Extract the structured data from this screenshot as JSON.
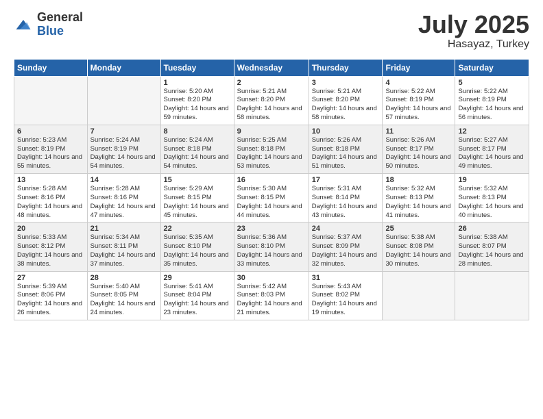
{
  "logo": {
    "general": "General",
    "blue": "Blue"
  },
  "title": {
    "month_year": "July 2025",
    "location": "Hasayaz, Turkey"
  },
  "weekdays": [
    "Sunday",
    "Monday",
    "Tuesday",
    "Wednesday",
    "Thursday",
    "Friday",
    "Saturday"
  ],
  "weeks": [
    [
      {
        "day": "",
        "sunrise": "",
        "sunset": "",
        "daylight": ""
      },
      {
        "day": "",
        "sunrise": "",
        "sunset": "",
        "daylight": ""
      },
      {
        "day": "1",
        "sunrise": "Sunrise: 5:20 AM",
        "sunset": "Sunset: 8:20 PM",
        "daylight": "Daylight: 14 hours and 59 minutes."
      },
      {
        "day": "2",
        "sunrise": "Sunrise: 5:21 AM",
        "sunset": "Sunset: 8:20 PM",
        "daylight": "Daylight: 14 hours and 58 minutes."
      },
      {
        "day": "3",
        "sunrise": "Sunrise: 5:21 AM",
        "sunset": "Sunset: 8:20 PM",
        "daylight": "Daylight: 14 hours and 58 minutes."
      },
      {
        "day": "4",
        "sunrise": "Sunrise: 5:22 AM",
        "sunset": "Sunset: 8:19 PM",
        "daylight": "Daylight: 14 hours and 57 minutes."
      },
      {
        "day": "5",
        "sunrise": "Sunrise: 5:22 AM",
        "sunset": "Sunset: 8:19 PM",
        "daylight": "Daylight: 14 hours and 56 minutes."
      }
    ],
    [
      {
        "day": "6",
        "sunrise": "Sunrise: 5:23 AM",
        "sunset": "Sunset: 8:19 PM",
        "daylight": "Daylight: 14 hours and 55 minutes."
      },
      {
        "day": "7",
        "sunrise": "Sunrise: 5:24 AM",
        "sunset": "Sunset: 8:19 PM",
        "daylight": "Daylight: 14 hours and 54 minutes."
      },
      {
        "day": "8",
        "sunrise": "Sunrise: 5:24 AM",
        "sunset": "Sunset: 8:18 PM",
        "daylight": "Daylight: 14 hours and 54 minutes."
      },
      {
        "day": "9",
        "sunrise": "Sunrise: 5:25 AM",
        "sunset": "Sunset: 8:18 PM",
        "daylight": "Daylight: 14 hours and 53 minutes."
      },
      {
        "day": "10",
        "sunrise": "Sunrise: 5:26 AM",
        "sunset": "Sunset: 8:18 PM",
        "daylight": "Daylight: 14 hours and 51 minutes."
      },
      {
        "day": "11",
        "sunrise": "Sunrise: 5:26 AM",
        "sunset": "Sunset: 8:17 PM",
        "daylight": "Daylight: 14 hours and 50 minutes."
      },
      {
        "day": "12",
        "sunrise": "Sunrise: 5:27 AM",
        "sunset": "Sunset: 8:17 PM",
        "daylight": "Daylight: 14 hours and 49 minutes."
      }
    ],
    [
      {
        "day": "13",
        "sunrise": "Sunrise: 5:28 AM",
        "sunset": "Sunset: 8:16 PM",
        "daylight": "Daylight: 14 hours and 48 minutes."
      },
      {
        "day": "14",
        "sunrise": "Sunrise: 5:28 AM",
        "sunset": "Sunset: 8:16 PM",
        "daylight": "Daylight: 14 hours and 47 minutes."
      },
      {
        "day": "15",
        "sunrise": "Sunrise: 5:29 AM",
        "sunset": "Sunset: 8:15 PM",
        "daylight": "Daylight: 14 hours and 45 minutes."
      },
      {
        "day": "16",
        "sunrise": "Sunrise: 5:30 AM",
        "sunset": "Sunset: 8:15 PM",
        "daylight": "Daylight: 14 hours and 44 minutes."
      },
      {
        "day": "17",
        "sunrise": "Sunrise: 5:31 AM",
        "sunset": "Sunset: 8:14 PM",
        "daylight": "Daylight: 14 hours and 43 minutes."
      },
      {
        "day": "18",
        "sunrise": "Sunrise: 5:32 AM",
        "sunset": "Sunset: 8:13 PM",
        "daylight": "Daylight: 14 hours and 41 minutes."
      },
      {
        "day": "19",
        "sunrise": "Sunrise: 5:32 AM",
        "sunset": "Sunset: 8:13 PM",
        "daylight": "Daylight: 14 hours and 40 minutes."
      }
    ],
    [
      {
        "day": "20",
        "sunrise": "Sunrise: 5:33 AM",
        "sunset": "Sunset: 8:12 PM",
        "daylight": "Daylight: 14 hours and 38 minutes."
      },
      {
        "day": "21",
        "sunrise": "Sunrise: 5:34 AM",
        "sunset": "Sunset: 8:11 PM",
        "daylight": "Daylight: 14 hours and 37 minutes."
      },
      {
        "day": "22",
        "sunrise": "Sunrise: 5:35 AM",
        "sunset": "Sunset: 8:10 PM",
        "daylight": "Daylight: 14 hours and 35 minutes."
      },
      {
        "day": "23",
        "sunrise": "Sunrise: 5:36 AM",
        "sunset": "Sunset: 8:10 PM",
        "daylight": "Daylight: 14 hours and 33 minutes."
      },
      {
        "day": "24",
        "sunrise": "Sunrise: 5:37 AM",
        "sunset": "Sunset: 8:09 PM",
        "daylight": "Daylight: 14 hours and 32 minutes."
      },
      {
        "day": "25",
        "sunrise": "Sunrise: 5:38 AM",
        "sunset": "Sunset: 8:08 PM",
        "daylight": "Daylight: 14 hours and 30 minutes."
      },
      {
        "day": "26",
        "sunrise": "Sunrise: 5:38 AM",
        "sunset": "Sunset: 8:07 PM",
        "daylight": "Daylight: 14 hours and 28 minutes."
      }
    ],
    [
      {
        "day": "27",
        "sunrise": "Sunrise: 5:39 AM",
        "sunset": "Sunset: 8:06 PM",
        "daylight": "Daylight: 14 hours and 26 minutes."
      },
      {
        "day": "28",
        "sunrise": "Sunrise: 5:40 AM",
        "sunset": "Sunset: 8:05 PM",
        "daylight": "Daylight: 14 hours and 24 minutes."
      },
      {
        "day": "29",
        "sunrise": "Sunrise: 5:41 AM",
        "sunset": "Sunset: 8:04 PM",
        "daylight": "Daylight: 14 hours and 23 minutes."
      },
      {
        "day": "30",
        "sunrise": "Sunrise: 5:42 AM",
        "sunset": "Sunset: 8:03 PM",
        "daylight": "Daylight: 14 hours and 21 minutes."
      },
      {
        "day": "31",
        "sunrise": "Sunrise: 5:43 AM",
        "sunset": "Sunset: 8:02 PM",
        "daylight": "Daylight: 14 hours and 19 minutes."
      },
      {
        "day": "",
        "sunrise": "",
        "sunset": "",
        "daylight": ""
      },
      {
        "day": "",
        "sunrise": "",
        "sunset": "",
        "daylight": ""
      }
    ]
  ]
}
